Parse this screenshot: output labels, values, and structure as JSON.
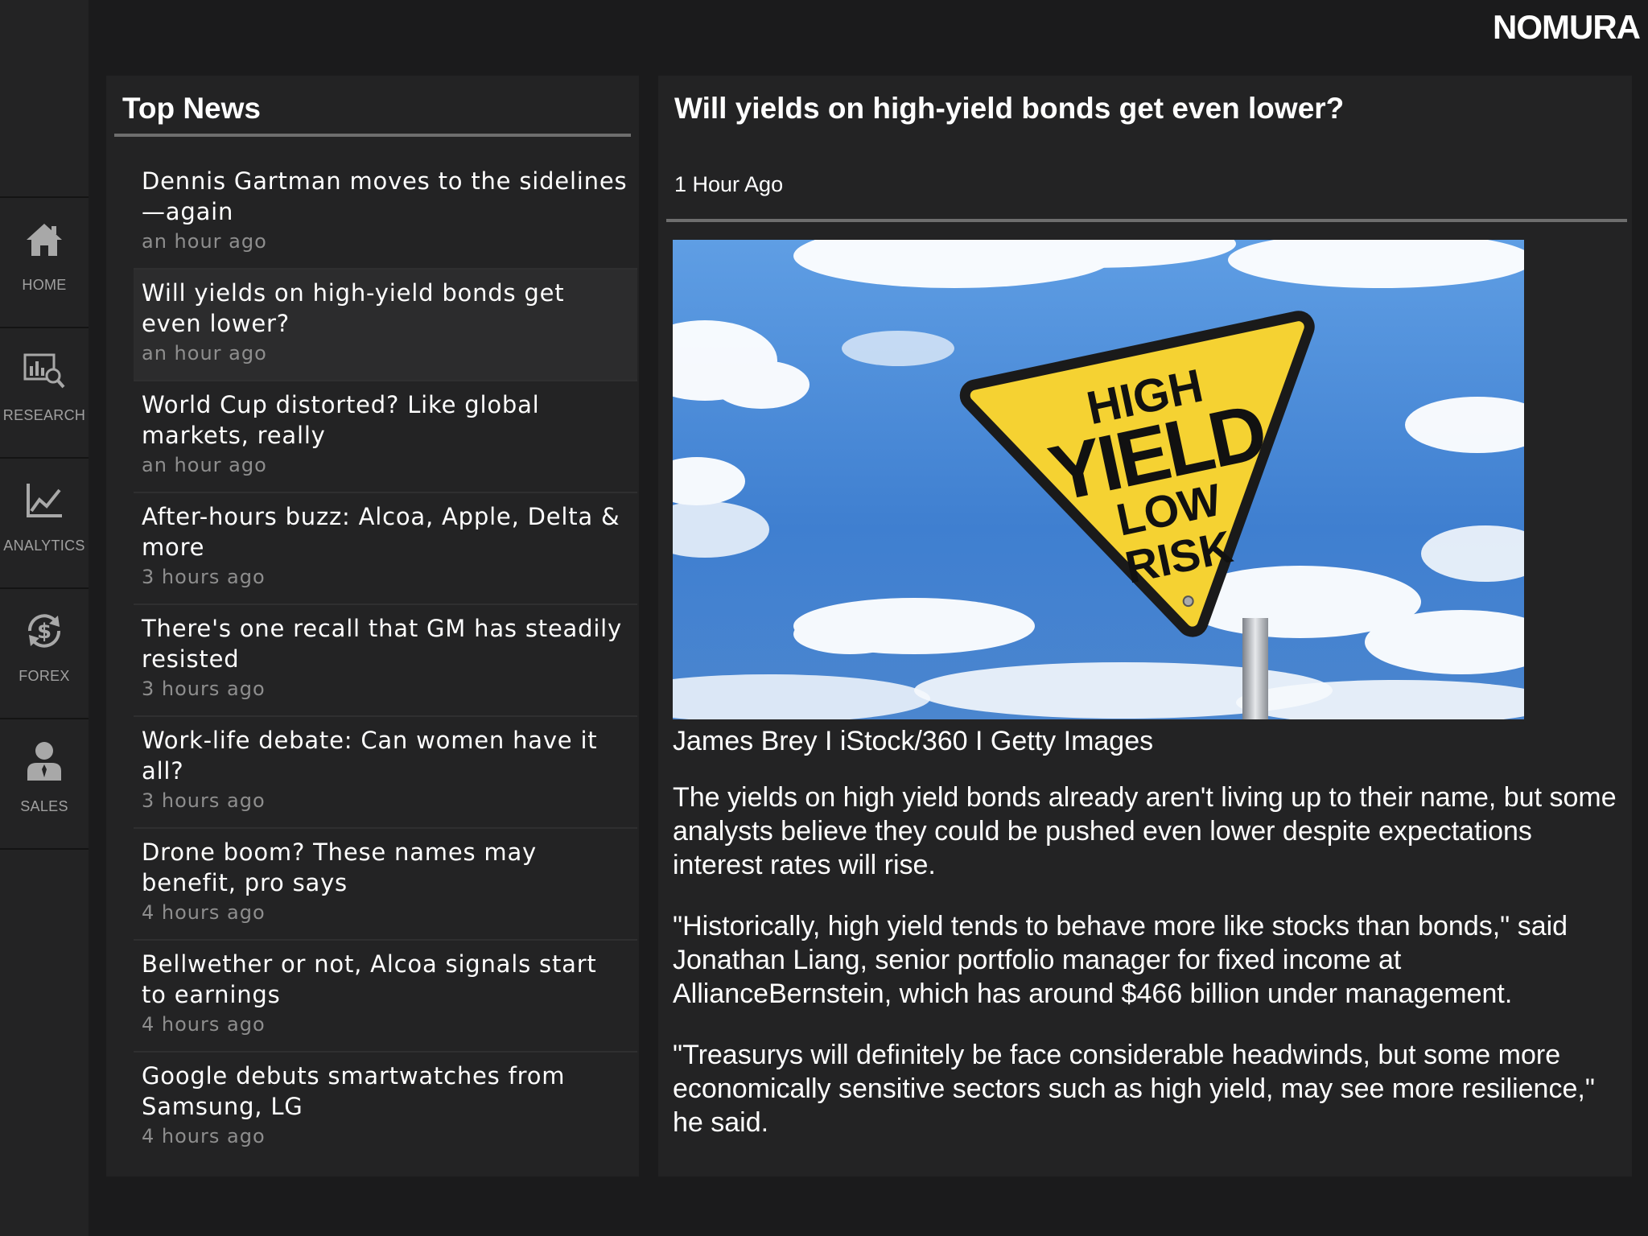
{
  "brand": {
    "logo_text": "NOMURA"
  },
  "sidebar": {
    "items": [
      {
        "label": "HOME",
        "icon": "home-icon"
      },
      {
        "label": "RESEARCH",
        "icon": "research-icon"
      },
      {
        "label": "ANALYTICS",
        "icon": "analytics-icon"
      },
      {
        "label": "FOREX",
        "icon": "forex-icon"
      },
      {
        "label": "SALES",
        "icon": "sales-icon"
      }
    ]
  },
  "top_news": {
    "title": "Top News",
    "items": [
      {
        "headline": "Dennis Gartman moves to the sidelines—again",
        "time": "an hour ago"
      },
      {
        "headline": "Will yields on high-yield bonds get even lower?",
        "time": "an hour ago",
        "selected": true
      },
      {
        "headline": "World Cup distorted? Like global markets, really",
        "time": "an hour ago"
      },
      {
        "headline": "After-hours buzz: Alcoa, Apple, Delta & more",
        "time": "3 hours ago"
      },
      {
        "headline": "There's one recall that GM has steadily resisted",
        "time": "3 hours ago"
      },
      {
        "headline": "Work-life debate: Can women have it all?",
        "time": "3 hours ago"
      },
      {
        "headline": "Drone boom? These names may benefit, pro says",
        "time": "4 hours ago"
      },
      {
        "headline": "Bellwether or not, Alcoa signals start to earnings",
        "time": "4 hours ago"
      },
      {
        "headline": "Google debuts smartwatches from Samsung, LG",
        "time": "4 hours ago"
      }
    ]
  },
  "article": {
    "title": "Will yields on high-yield bonds get even lower?",
    "time": "1 Hour Ago",
    "image": {
      "sign_line1": "HIGH",
      "sign_line2": "YIELD",
      "sign_line3": "LOW",
      "sign_line4": "RISK"
    },
    "caption": "James Brey I iStock/360 I Getty Images",
    "paragraphs": [
      "The yields on high yield bonds already aren't living up to their name, but some analysts believe they could be pushed even lower despite expectations interest rates will rise.",
      "\"Historically, high yield tends to behave more like stocks than bonds,\" said Jonathan Liang, senior portfolio manager for fixed income at AllianceBernstein, which has around $466 billion under management.",
      "\"Treasurys will definitely be face considerable headwinds, but some more economically sensitive sectors such as high yield, may see more resilience,\" he said."
    ]
  },
  "colors": {
    "background": "#1b1b1c",
    "panel": "#232324",
    "selected_row": "#2c2c2d",
    "muted_text": "#8e8e8e",
    "sign_yellow": "#f5d232",
    "sky_blue": "#3f78c4"
  }
}
